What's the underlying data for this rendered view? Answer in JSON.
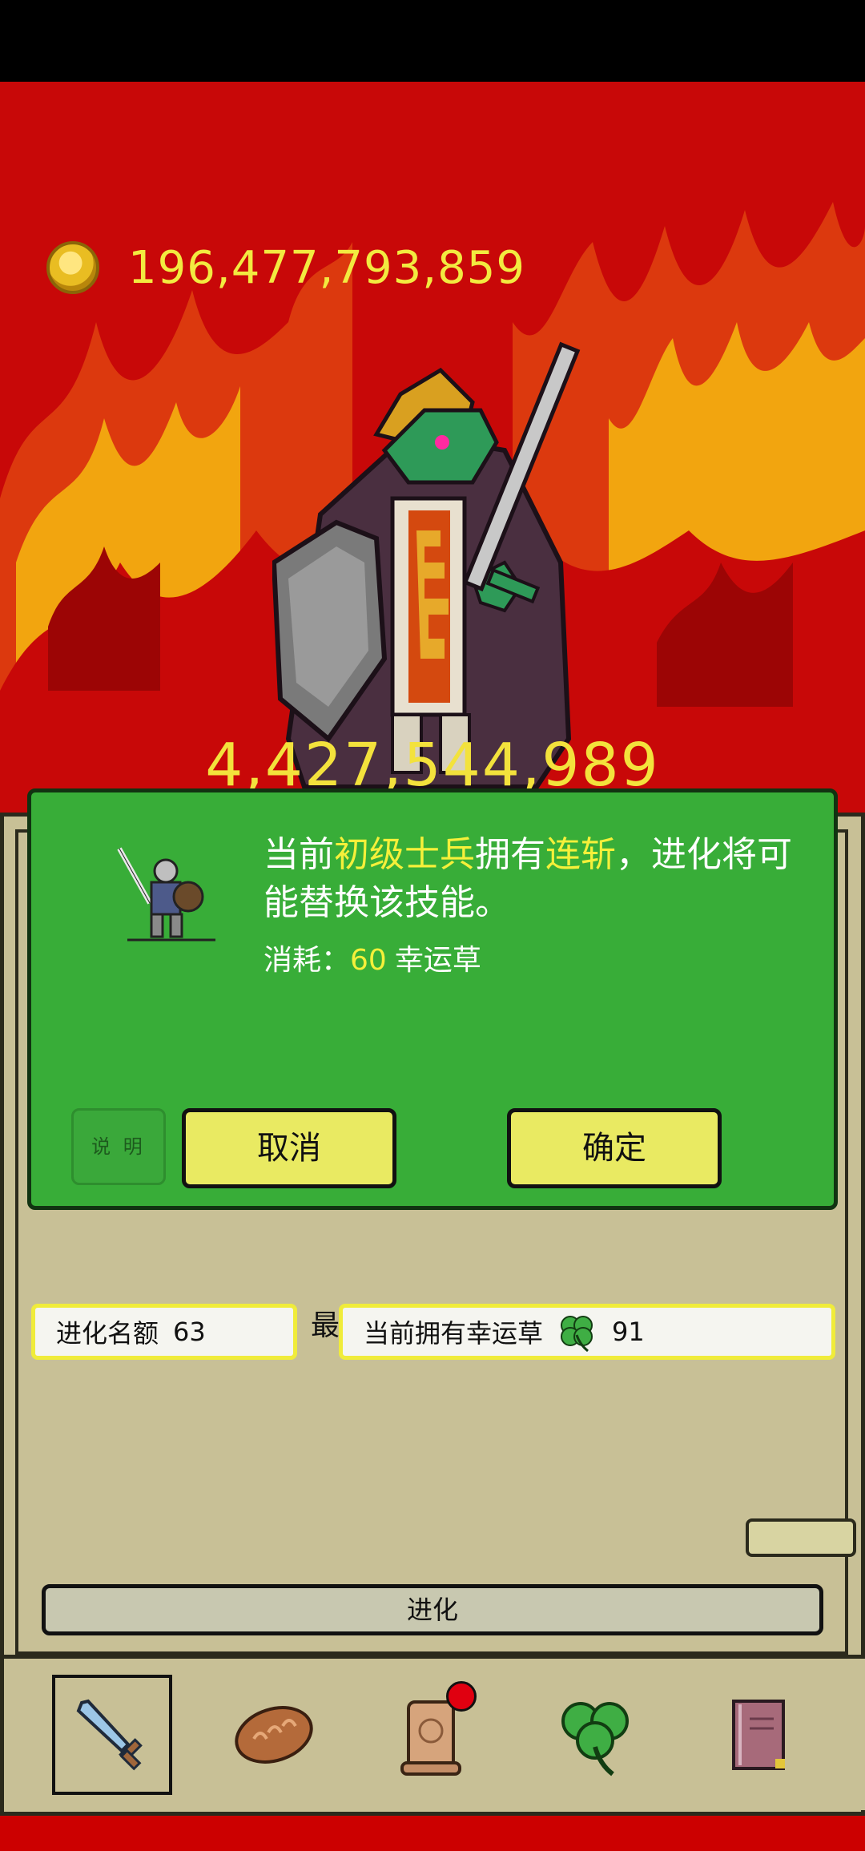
{
  "header": {
    "gold_amount": "196,477,793,859",
    "power_value": "4,427,544,989"
  },
  "dialog": {
    "msg_prefix": "当前",
    "unit_name": "初级士兵",
    "msg_mid": "拥有",
    "skill_name": "连斩",
    "msg_suffix": "，进化将可能替换该技能。",
    "cost_label": "消耗：",
    "cost_value": "60",
    "cost_unit": "幸运草",
    "help_label": "说 明",
    "cancel_label": "取消",
    "confirm_label": "确定"
  },
  "panel": {
    "quota_label": "进化名额",
    "quota_value": "63",
    "partial_text": "最",
    "clover_label": "当前拥有幸运草",
    "clover_value": "91",
    "evolve_label": "进化"
  },
  "tabs": [
    {
      "icon": "sword-icon",
      "active": true
    },
    {
      "icon": "bread-icon",
      "active": false
    },
    {
      "icon": "scroll-icon",
      "active": false,
      "badge": true
    },
    {
      "icon": "clover-icon",
      "active": false
    },
    {
      "icon": "book-icon",
      "active": false
    }
  ],
  "colors": {
    "highlight": "#f5f03a",
    "dialog_bg": "#38ad38",
    "button_yellow": "#e9ea62",
    "scene_red": "#cc0000"
  }
}
